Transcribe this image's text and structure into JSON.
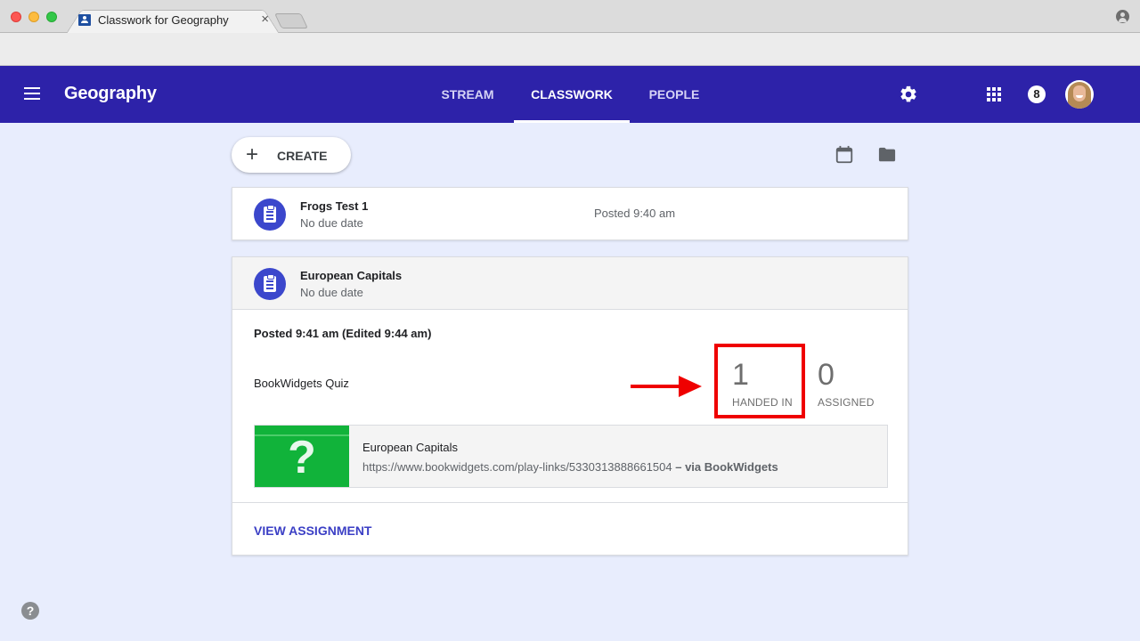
{
  "browser": {
    "tab_title": "Classwork for Geography",
    "tab_close": "×",
    "favicon": "classroom-icon",
    "profile_icon": "account-circle-icon"
  },
  "header": {
    "class_name": "Geography",
    "tabs": [
      {
        "label": "STREAM",
        "active": false
      },
      {
        "label": "CLASSWORK",
        "active": true
      },
      {
        "label": "PEOPLE",
        "active": false
      }
    ],
    "notification_count": "8",
    "colors": {
      "appbar": "#2d22a9",
      "accent": "#3b47cc"
    }
  },
  "toolbar": {
    "create_icon": "+",
    "create_label": "CREATE",
    "calendar_icon": "calendar-icon",
    "folder_icon": "folder-icon"
  },
  "assignments": [
    {
      "title": "Frogs Test 1",
      "due": "No due date",
      "posted": "Posted 9:40 am"
    },
    {
      "title": "European Capitals",
      "due": "No due date",
      "posted_detail": "Posted 9:41 am (Edited 9:44 am)",
      "description": "BookWidgets Quiz",
      "stats": [
        {
          "value": "1",
          "label": "HANDED IN",
          "highlighted": true
        },
        {
          "value": "0",
          "label": "ASSIGNED",
          "highlighted": false
        }
      ],
      "attachment": {
        "thumb_glyph": "?",
        "title": "European Capitals",
        "url": "https://www.bookwidgets.com/play-links/5330313888661504",
        "via": " – via BookWidgets"
      },
      "action_label": "VIEW ASSIGNMENT"
    }
  ],
  "annotation": {
    "color": "#ef0000"
  },
  "help_glyph": "?"
}
